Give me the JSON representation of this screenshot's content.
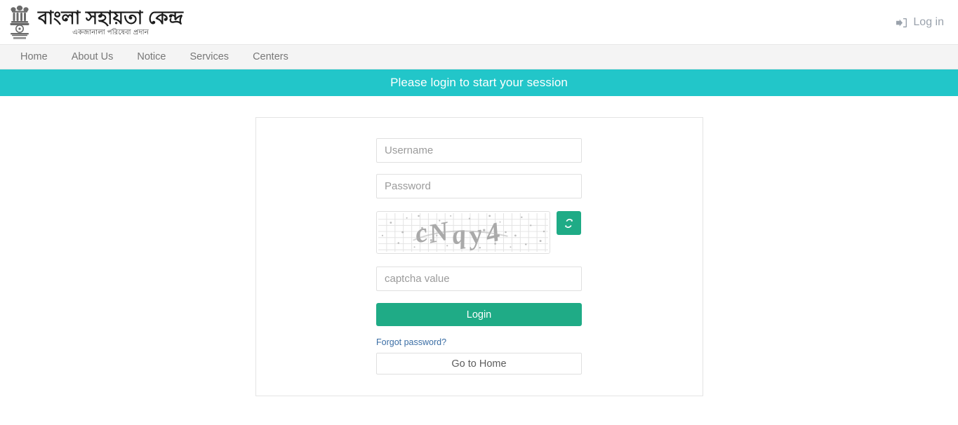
{
  "header": {
    "emblem_name": "india-national-emblem",
    "brand_title": "বাংলা সহায়তা কেন্দ্র",
    "brand_subtitle": "একজানালা পরিষেবা প্রদান",
    "login_label": "Log in",
    "login_icon": "sign-in-icon"
  },
  "nav": {
    "items": [
      {
        "label": "Home"
      },
      {
        "label": "About Us"
      },
      {
        "label": "Notice"
      },
      {
        "label": "Services"
      },
      {
        "label": "Centers"
      }
    ]
  },
  "banner": {
    "message": "Please login to start your session",
    "background_color": "#22c6c9",
    "text_color": "#ffffff"
  },
  "login_form": {
    "username": {
      "value": "",
      "placeholder": "Username"
    },
    "password": {
      "value": "",
      "placeholder": "Password"
    },
    "captcha": {
      "text": "cNqy4",
      "refresh_icon": "refresh-icon",
      "input": {
        "value": "",
        "placeholder": "captcha value"
      }
    },
    "login_button": "Login",
    "forgot_password_link": "Forgot password?",
    "home_button": "Go to Home"
  },
  "colors": {
    "teal_banner": "#22c6c9",
    "green_accent": "#1fab86",
    "nav_background": "#f4f4f4",
    "link_blue": "#3b6ea5"
  }
}
